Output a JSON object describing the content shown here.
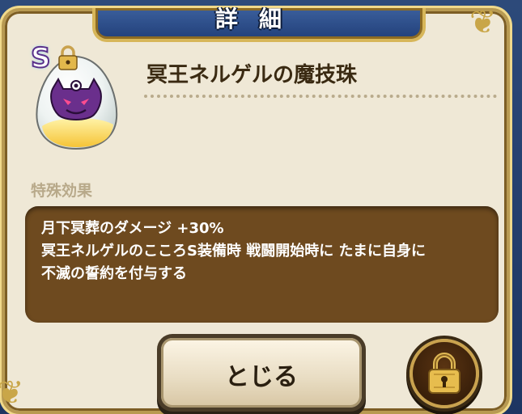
{
  "header": {
    "title": "詳細"
  },
  "item": {
    "rank": "S",
    "name": "冥王ネルゲルの魔技珠",
    "icon": "demon-orb-icon"
  },
  "effects": {
    "label": "特殊効果",
    "text": "月下冥葬のダメージ +30%\n冥王ネルゲルのこころS装備時 戦闘開始時に たまに自身に\n不滅の誓約を付与する"
  },
  "buttons": {
    "close_label": "とじる",
    "lock_icon": "padlock-icon"
  },
  "colors": {
    "panel_bg": "#efe8d6",
    "effect_box": "#6e4a1f",
    "header_blue": "#2d4a7a",
    "gold_trim": "#c9a648"
  }
}
